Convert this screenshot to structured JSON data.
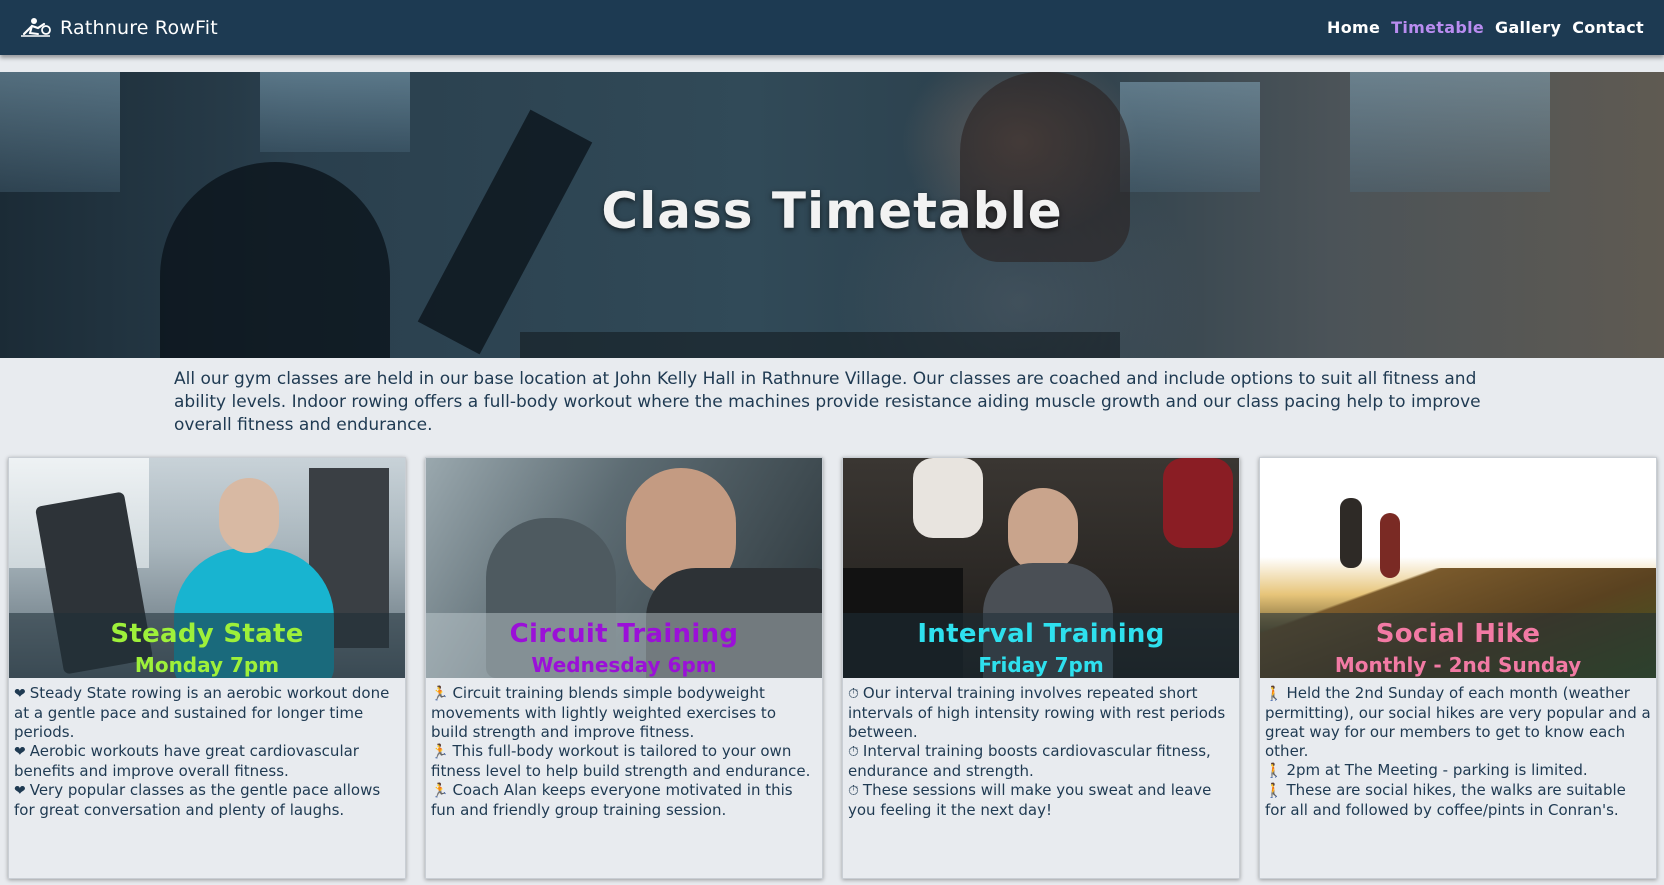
{
  "nav": {
    "brand": "Rathnure RowFit",
    "links": [
      {
        "label": "Home",
        "active": false
      },
      {
        "label": "Timetable",
        "active": true
      },
      {
        "label": "Gallery",
        "active": false
      },
      {
        "label": "Contact",
        "active": false
      }
    ],
    "active_color": "#b98cf0"
  },
  "hero": {
    "title": "Class Timetable"
  },
  "intro": "All our gym classes are held in our base location at John Kelly Hall in Rathnure Village. Our classes are coached and include options to suit all fitness and ability levels. Indoor rowing offers a full-body workout where the machines provide resistance aiding muscle growth and our class pacing help to improve overall fitness and endurance.",
  "cards": [
    {
      "title": "Steady State",
      "time": "Monday 7pm",
      "color": "#9ef03a",
      "icon": "heartbeat-icon",
      "lines": [
        "Steady State rowing is an aerobic workout done at a gentle pace and sustained for longer time periods.",
        "Aerobic workouts have great cardiovascular benefits and improve overall fitness.",
        "Very popular classes as the gentle pace allows for great conversation and plenty of laughs."
      ]
    },
    {
      "title": "Circuit Training",
      "time": "Wednesday 6pm",
      "color": "#9b10d8",
      "icon": "running-icon",
      "lines": [
        "Circuit training blends simple bodyweight movements with lightly weighted exercises to build strength and improve fitness.",
        "This full-body workout is tailored to your own fitness level to help build strength and endurance.",
        "Coach Alan keeps everyone motivated in this fun and friendly group training session."
      ]
    },
    {
      "title": "Interval Training",
      "time": "Friday 7pm",
      "color": "#2ee0ee",
      "icon": "stopwatch-icon",
      "lines": [
        "Our interval training involves repeated short intervals of high intensity rowing with rest periods between.",
        "Interval training boosts cardiovascular fitness, endurance and strength.",
        "These sessions will make you sweat and leave you feeling it the next day!"
      ]
    },
    {
      "title": "Social Hike",
      "time": "Monthly - 2nd Sunday",
      "color": "#f27aa4",
      "icon": "hiking-icon",
      "lines": [
        "Held the 2nd Sunday of each month (weather permitting), our social hikes are very popular and a great way for our members to get to know each other.",
        "2pm at The Meeting - parking is limited.",
        "These are social hikes, the walks are suitable for all and followed by coffee/pints in Conran's."
      ]
    }
  ]
}
